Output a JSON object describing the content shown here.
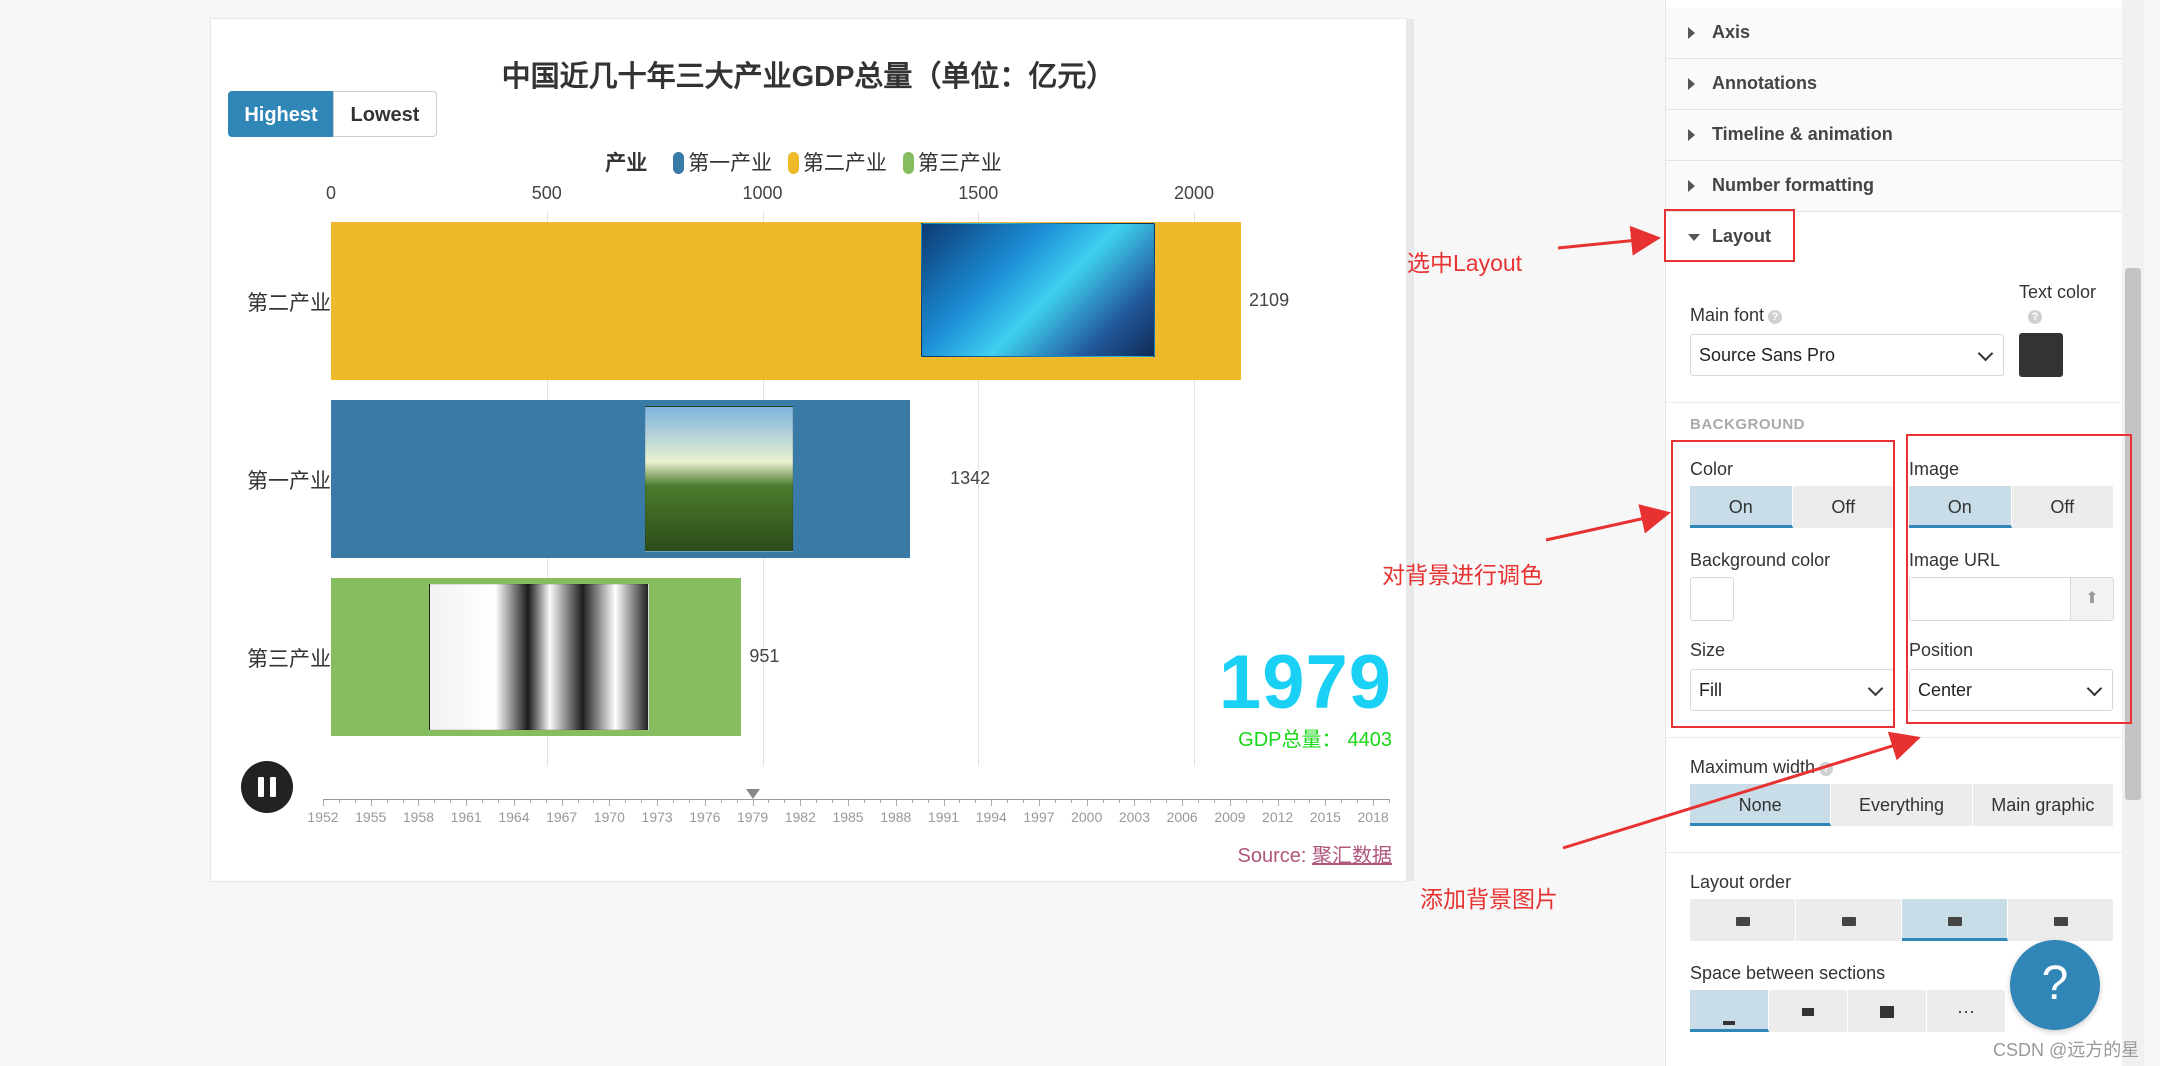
{
  "chart": {
    "title": "中国近几十年三大产业GDP总量（单位：亿元）",
    "toggle": {
      "highest": "Highest",
      "lowest": "Lowest"
    },
    "legend_title": "产业",
    "year": "1979",
    "total_label": "GDP总量：",
    "total_value": "4403",
    "source_label": "Source:",
    "source_link": "聚汇数据",
    "timeline_marker_year": 1979
  },
  "chart_data": {
    "type": "bar",
    "orientation": "horizontal",
    "title": "中国近几十年三大产业GDP总量（单位：亿元）",
    "xlim": [
      0,
      2150
    ],
    "x_ticks": [
      "0",
      "500",
      "1000",
      "1500",
      "2000"
    ],
    "categories": [
      "第二产业",
      "第一产业",
      "第三产业"
    ],
    "values": [
      2109,
      1342,
      951
    ],
    "value_labels": [
      "2109",
      "1342",
      "951"
    ],
    "colors": [
      "#efb92c",
      "#3a7aa6",
      "#86bd61"
    ],
    "legend": [
      {
        "label": "第一产业",
        "color": "#3a7aa6"
      },
      {
        "label": "第二产业",
        "color": "#efb92c"
      },
      {
        "label": "第三产业",
        "color": "#86bd61"
      }
    ],
    "legend_placement": "top",
    "grid": true,
    "timeline_labels": [
      "1952",
      "1955",
      "1958",
      "1961",
      "1964",
      "1967",
      "1970",
      "1973",
      "1976",
      "1979",
      "1982",
      "1985",
      "1988",
      "1991",
      "1994",
      "1997",
      "2000",
      "2003",
      "2006",
      "2009",
      "2012",
      "2015",
      "2018"
    ]
  },
  "annotations": {
    "select_layout": "选中Layout",
    "bg_color": "对背景进行调色",
    "bg_image": "添加背景图片"
  },
  "panel": {
    "sections": [
      "Axis",
      "Annotations",
      "Timeline & animation",
      "Number formatting",
      "Layout"
    ],
    "main_font_label": "Main font",
    "main_font_value": "Source Sans Pro",
    "text_color_label": "Text color",
    "text_color_value": "#333333",
    "background_title": "BACKGROUND",
    "color_label": "Color",
    "on": "On",
    "off": "Off",
    "image_label": "Image",
    "bg_color_label": "Background color",
    "bg_color_value": "#ffffff",
    "image_url_label": "Image URL",
    "upload_icon": "upload-icon",
    "upload_glyph": "⬆",
    "size_label": "Size",
    "size_value": "Fill",
    "position_label": "Position",
    "position_value": "Center",
    "max_width_label": "Maximum width",
    "max_width_options": [
      "None",
      "Everything",
      "Main graphic"
    ],
    "layout_order_label": "Layout order",
    "space_label": "Space between sections",
    "space_more": "···",
    "help_glyph": "?"
  },
  "watermark": "CSDN @远方的星"
}
